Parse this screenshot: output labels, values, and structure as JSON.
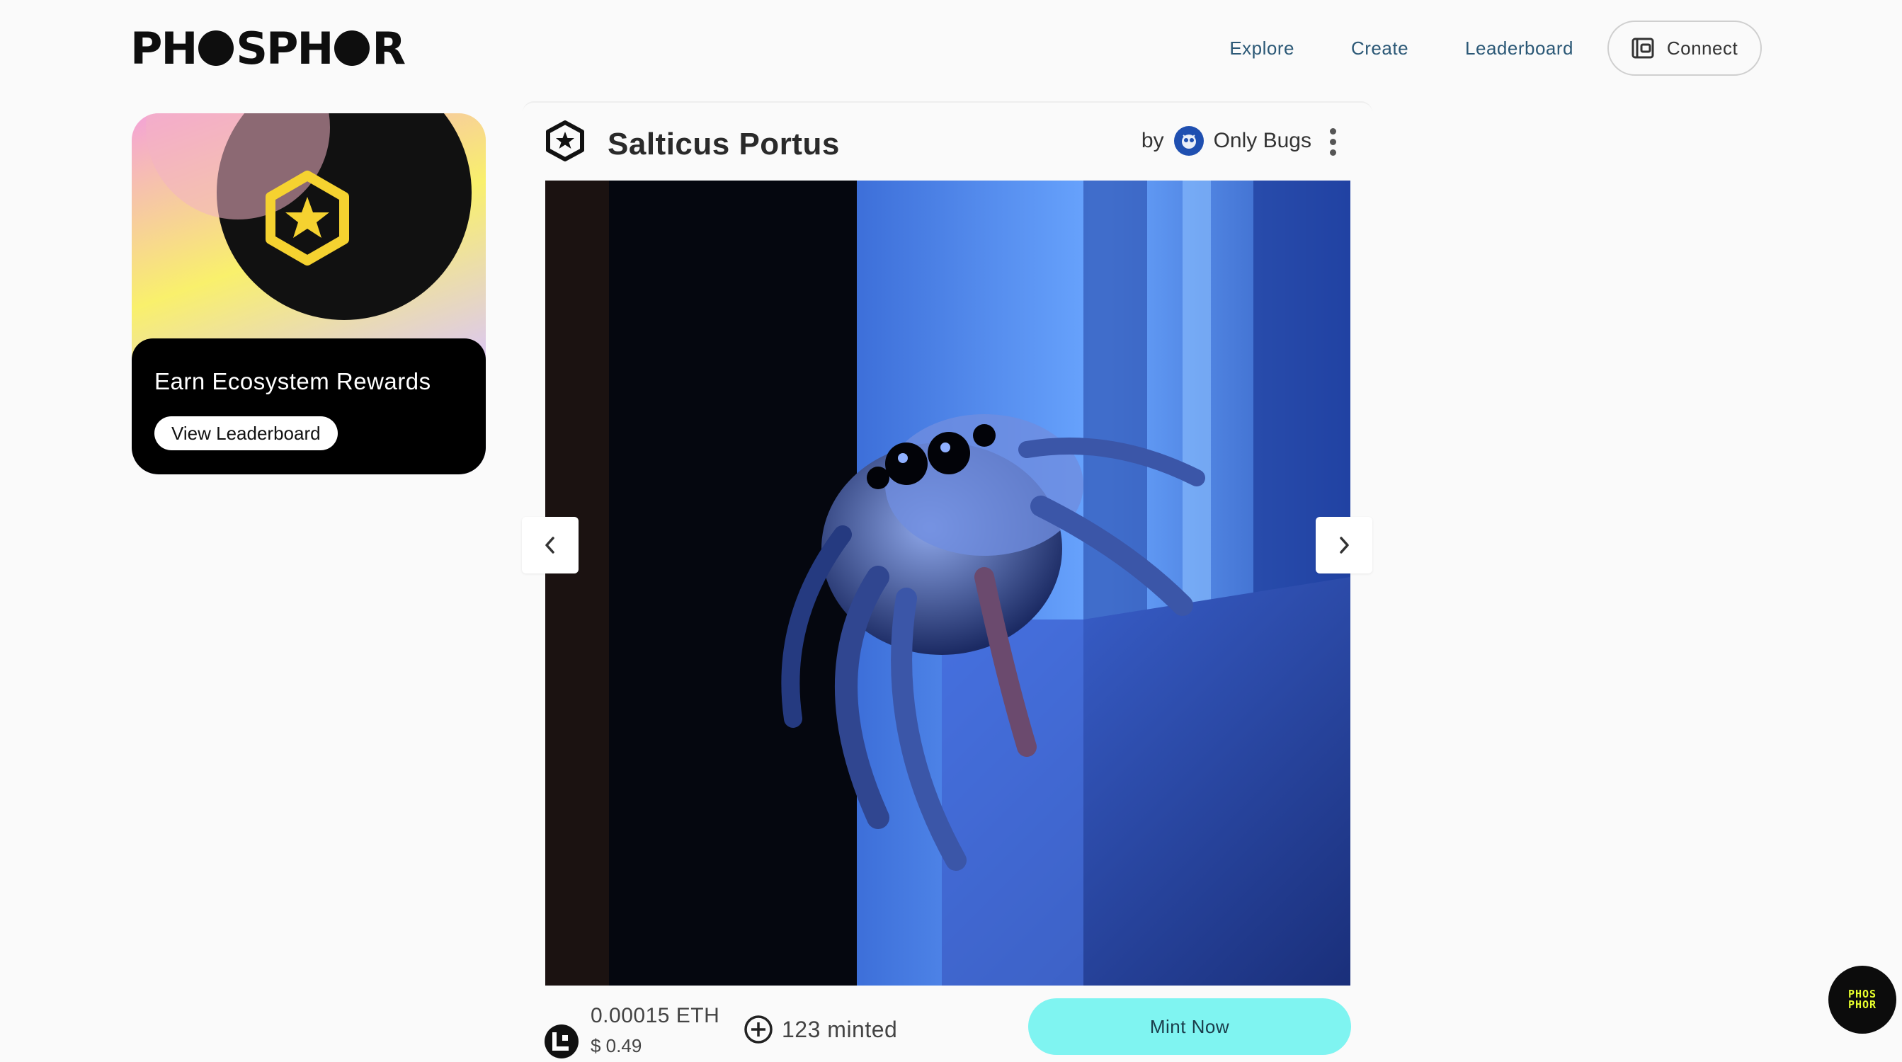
{
  "header": {
    "logo_text": "PHOSPHOR",
    "nav": [
      {
        "label": "Explore"
      },
      {
        "label": "Create"
      },
      {
        "label": "Leaderboard"
      }
    ],
    "connect_label": "Connect"
  },
  "rewards_card": {
    "title": "Earn Ecosystem Rewards",
    "button_label": "View Leaderboard"
  },
  "nft": {
    "title": "Salticus Portus",
    "creator_prefix": "by",
    "creator_name": "Only Bugs",
    "image_icon": "jumping-spider-photo",
    "price_eth": "0.00015 ETH",
    "price_usd": "$ 0.49",
    "minted": "123 minted",
    "mint_button": "Mint Now"
  },
  "corner_badge": {
    "text": "PHOSPHOR"
  },
  "colors": {
    "accent_mint": "#7ff4f1",
    "nav_text": "#2b5876",
    "badge_yellow": "#e7ff2c",
    "rewards_icon_yellow": "#f5d230"
  }
}
